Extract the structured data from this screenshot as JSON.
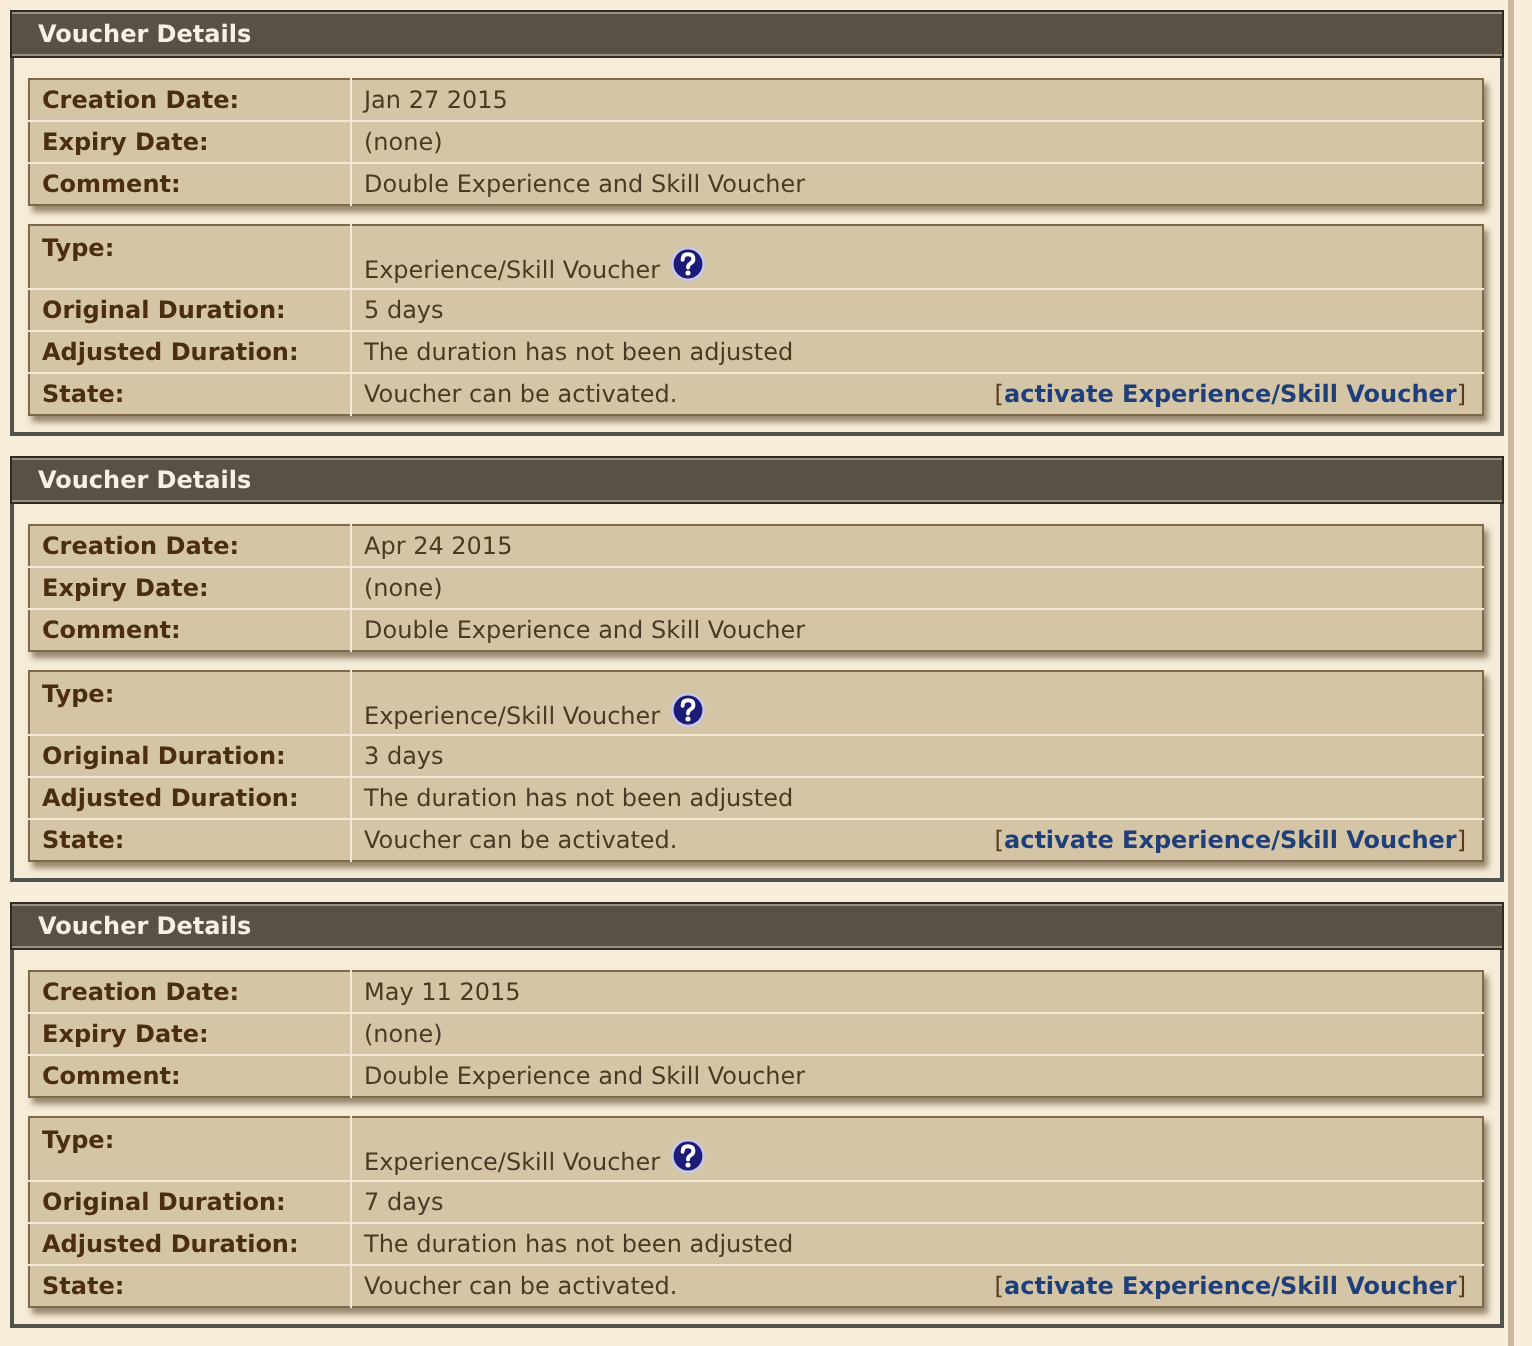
{
  "vouchers": [
    {
      "title": "Voucher Details",
      "general": [
        {
          "label": "Creation Date:",
          "value": "Jan 27 2015"
        },
        {
          "label": "Expiry Date:",
          "value": "(none)"
        },
        {
          "label": "Comment:",
          "value": "Double Experience and Skill Voucher"
        }
      ],
      "details": [
        {
          "kind": "help",
          "label": "Type:",
          "value": "Experience/Skill Voucher"
        },
        {
          "kind": "plain",
          "label": "Original Duration:",
          "value": "5 days"
        },
        {
          "kind": "plain",
          "label": "Adjusted Duration:",
          "value": "The duration has not been adjusted"
        },
        {
          "kind": "action",
          "label": "State:",
          "value": "Voucher can be activated.",
          "action": {
            "open": "[",
            "link": "activate Experience/Skill Voucher",
            "close": "]"
          }
        }
      ]
    },
    {
      "title": "Voucher Details",
      "general": [
        {
          "label": "Creation Date:",
          "value": "Apr 24 2015"
        },
        {
          "label": "Expiry Date:",
          "value": "(none)"
        },
        {
          "label": "Comment:",
          "value": "Double Experience and Skill Voucher"
        }
      ],
      "details": [
        {
          "kind": "help",
          "label": "Type:",
          "value": "Experience/Skill Voucher"
        },
        {
          "kind": "plain",
          "label": "Original Duration:",
          "value": "3 days"
        },
        {
          "kind": "plain",
          "label": "Adjusted Duration:",
          "value": "The duration has not been adjusted"
        },
        {
          "kind": "action",
          "label": "State:",
          "value": "Voucher can be activated.",
          "action": {
            "open": "[",
            "link": "activate Experience/Skill Voucher",
            "close": "]"
          }
        }
      ]
    },
    {
      "title": "Voucher Details",
      "general": [
        {
          "label": "Creation Date:",
          "value": "May 11 2015"
        },
        {
          "label": "Expiry Date:",
          "value": "(none)"
        },
        {
          "label": "Comment:",
          "value": "Double Experience and Skill Voucher"
        }
      ],
      "details": [
        {
          "kind": "help",
          "label": "Type:",
          "value": "Experience/Skill Voucher"
        },
        {
          "kind": "plain",
          "label": "Original Duration:",
          "value": "7 days"
        },
        {
          "kind": "plain",
          "label": "Adjusted Duration:",
          "value": "The duration has not been adjusted"
        },
        {
          "kind": "action",
          "label": "State:",
          "value": "Voucher can be activated.",
          "action": {
            "open": "[",
            "link": "activate Experience/Skill Voucher",
            "close": "]"
          }
        }
      ]
    }
  ]
}
